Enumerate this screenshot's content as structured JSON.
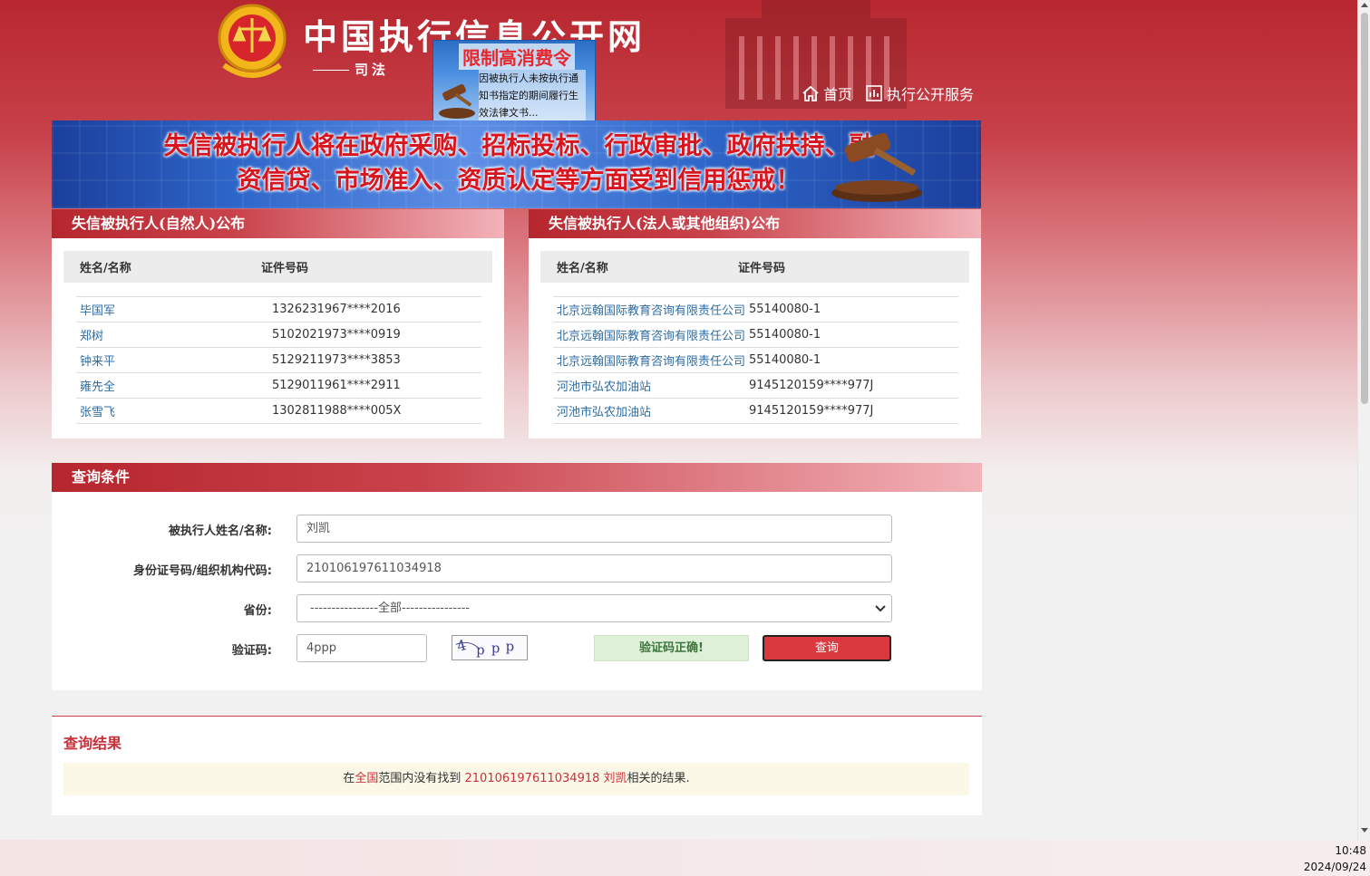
{
  "header": {
    "site_title": "中国执行信息公开网",
    "site_subtitle": "司法",
    "nav": [
      {
        "label": "首页",
        "icon": "home-icon"
      },
      {
        "label": "执行公开服务",
        "icon": "bar-chart-icon"
      }
    ]
  },
  "popup": {
    "title": "限制高消费令",
    "text": "因被执行人未按执行通知书指定的期间履行生效法律文书..."
  },
  "banner": {
    "line1": "失信被执行人将在政府采购、招标投标、行政审批、政府扶持、融",
    "line2": "资信贷、市场准入、资质认定等方面受到信用惩戒！"
  },
  "natural_panel": {
    "title": "失信被执行人(自然人)公布",
    "columns": [
      "姓名/名称",
      "证件号码"
    ],
    "rows": [
      {
        "name": "毕国军",
        "id": "1326231967****2016"
      },
      {
        "name": "郑树",
        "id": "5102021973****0919"
      },
      {
        "name": "钟来平",
        "id": "5129211973****3853"
      },
      {
        "name": "雍先全",
        "id": "5129011961****2911"
      },
      {
        "name": "张雪飞",
        "id": "1302811988****005X"
      }
    ]
  },
  "org_panel": {
    "title": "失信被执行人(法人或其他组织)公布",
    "columns": [
      "姓名/名称",
      "证件号码"
    ],
    "rows": [
      {
        "name": "北京远翰国际教育咨询有限责任公司",
        "id": "55140080-1"
      },
      {
        "name": "北京远翰国际教育咨询有限责任公司",
        "id": "55140080-1"
      },
      {
        "name": "北京远翰国际教育咨询有限责任公司",
        "id": "55140080-1"
      },
      {
        "name": "河池市弘农加油站",
        "id": "9145120159****977J"
      },
      {
        "name": "河池市弘农加油站",
        "id": "9145120159****977J"
      }
    ]
  },
  "search": {
    "title": "查询条件",
    "name_label": "被执行人姓名/名称:",
    "name_value": "刘凯",
    "id_label": "身份证号码/组织机构代码:",
    "id_value": "210106197611034918",
    "province_label": "省份:",
    "province_value": "----------------全部----------------",
    "captcha_label": "验证码:",
    "captcha_value": "4ppp",
    "captcha_image_text": "4ppp",
    "captcha_status": "验证码正确!",
    "query_button": "查询"
  },
  "results": {
    "title": "查询结果",
    "msg_prefix": "在",
    "msg_scope": "全国",
    "msg_mid": "范围内没有找到 ",
    "msg_query": "210106197611034918 刘凯",
    "msg_suffix": "相关的结果."
  },
  "taskbar": {
    "time": "10:48",
    "date": "2024/09/24"
  },
  "colors": {
    "brand_red": "#c9303a",
    "link_blue": "#2e6da4",
    "button_red": "#d9393f",
    "success_bg": "#dff0d8"
  }
}
